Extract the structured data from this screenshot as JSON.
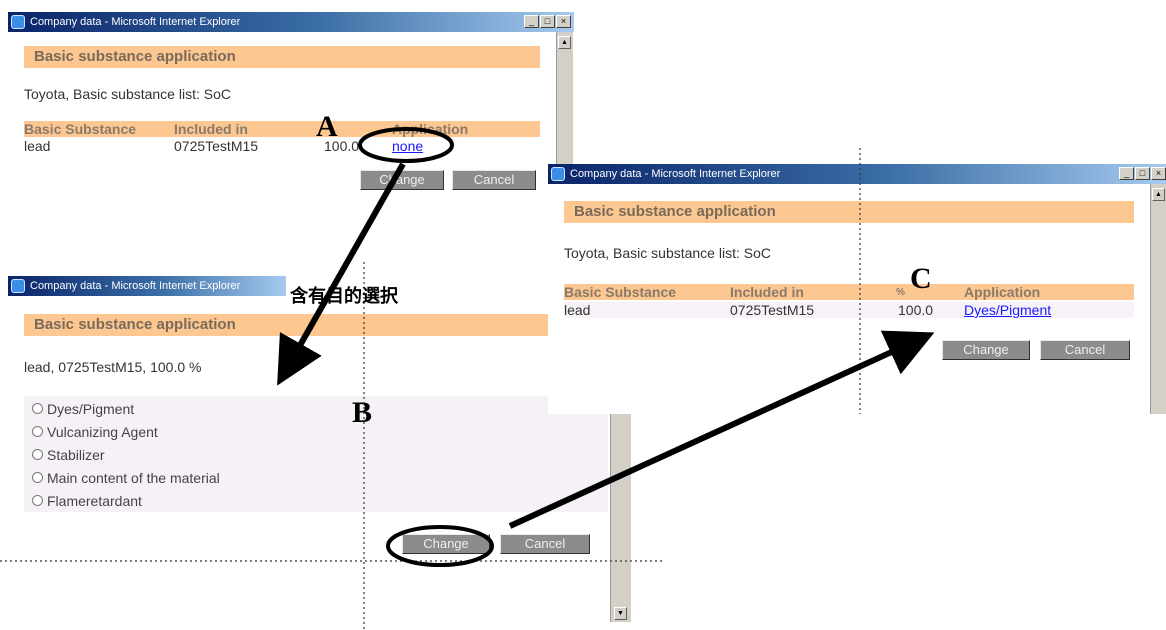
{
  "window_title": "Company data - Microsoft Internet Explorer",
  "heading": "Basic substance application",
  "list_label": "Toyota, Basic substance list: SoC",
  "columns": {
    "substance": "Basic Substance",
    "included": "Included in",
    "percent": "%",
    "application": "Application"
  },
  "win_a": {
    "row": {
      "substance": "lead",
      "included": "0725TestM15",
      "percent": "100.0",
      "application": "none"
    },
    "buttons": {
      "change": "Change",
      "cancel": "Cancel"
    }
  },
  "win_b": {
    "summary": "lead, 0725TestM15, 100.0 %",
    "options": [
      "Dyes/Pigment",
      "Vulcanizing Agent",
      "Stabilizer",
      "Main content of the material",
      "Flameretardant"
    ],
    "buttons": {
      "change": "Change",
      "cancel": "Cancel"
    },
    "jp_caption": "含有目的選択"
  },
  "win_c": {
    "row": {
      "substance": "lead",
      "included": "0725TestM15",
      "percent": "100.0",
      "application": "Dyes/Pigment"
    },
    "buttons": {
      "change": "Change",
      "cancel": "Cancel"
    }
  },
  "labels": {
    "a": "A",
    "b": "B",
    "c": "C"
  }
}
